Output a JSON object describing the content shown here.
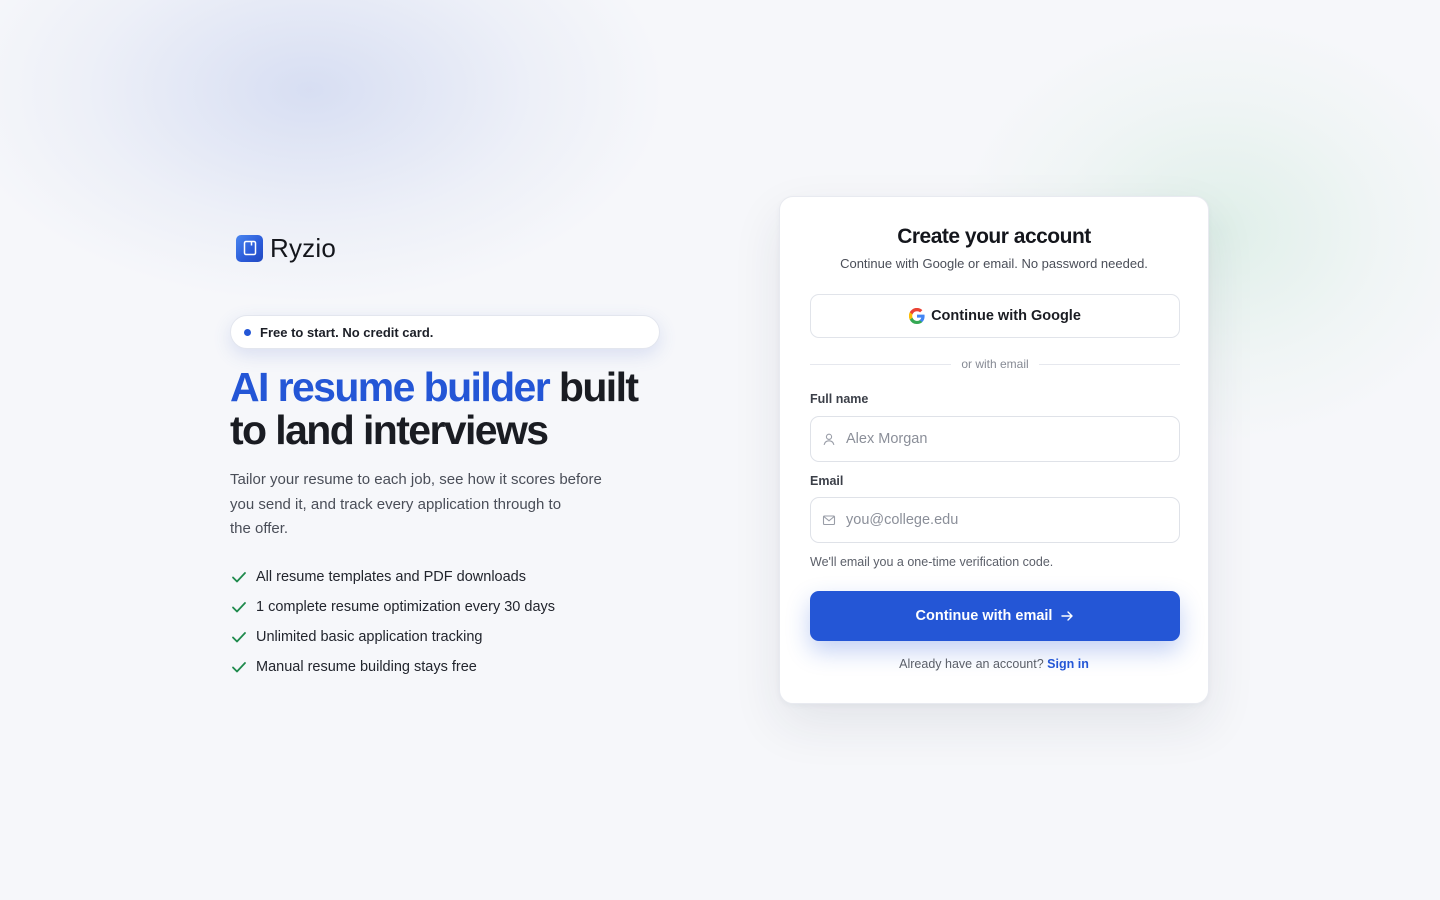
{
  "brand": {
    "name": "Ryzio",
    "logo_icon": "document-icon",
    "logo_color": "#2a5ad8"
  },
  "hero": {
    "badge": "Free to start. No credit card.",
    "headline_accent": "AI resume builder",
    "headline_rest_line1": " built",
    "headline_line2": "to land interviews",
    "description_lines": [
      "Tailor your resume to each job, see how it scores before",
      "you send it, and track every application through to",
      "the offer."
    ],
    "features": [
      "All resume templates and PDF downloads",
      "1 complete resume optimization every 30 days",
      "Unlimited basic application tracking",
      "Manual resume building stays free"
    ]
  },
  "card": {
    "title": "Create your account",
    "subtitle": "Continue with Google or email. No password needed.",
    "google_button": "Continue with Google",
    "divider": "or with email",
    "full_name_label": "Full name",
    "full_name_placeholder": "Alex Morgan",
    "email_label": "Email",
    "email_placeholder": "you@college.edu",
    "hint": "We'll email you a one-time verification code.",
    "submit_button": "Continue with email",
    "signin_prompt": "Already have an account?",
    "signin_link": "Sign in"
  },
  "colors": {
    "accent": "#2456d6",
    "check": "#1f8a4c",
    "background": "#f6f7fa"
  }
}
